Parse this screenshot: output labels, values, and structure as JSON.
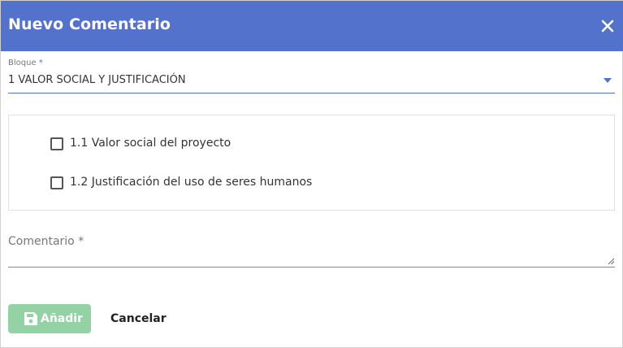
{
  "dialog": {
    "title": "Nuevo Comentario",
    "close_icon": "close-icon",
    "header_color": "#5372cb"
  },
  "bloque": {
    "label": "Bloque",
    "required_mark": "*",
    "value": "1 VALOR SOCIAL Y JUSTIFICACIÓN"
  },
  "items": [
    {
      "label": "1.1 Valor social del proyecto",
      "checked": false
    },
    {
      "label": "1.2 Justificación del uso de seres humanos",
      "checked": false
    }
  ],
  "comentario": {
    "label": "Comentario *",
    "value": ""
  },
  "actions": {
    "add_label": "Añadir",
    "add_icon": "save-icon",
    "add_color": "#93d2a3",
    "cancel_label": "Cancelar"
  }
}
